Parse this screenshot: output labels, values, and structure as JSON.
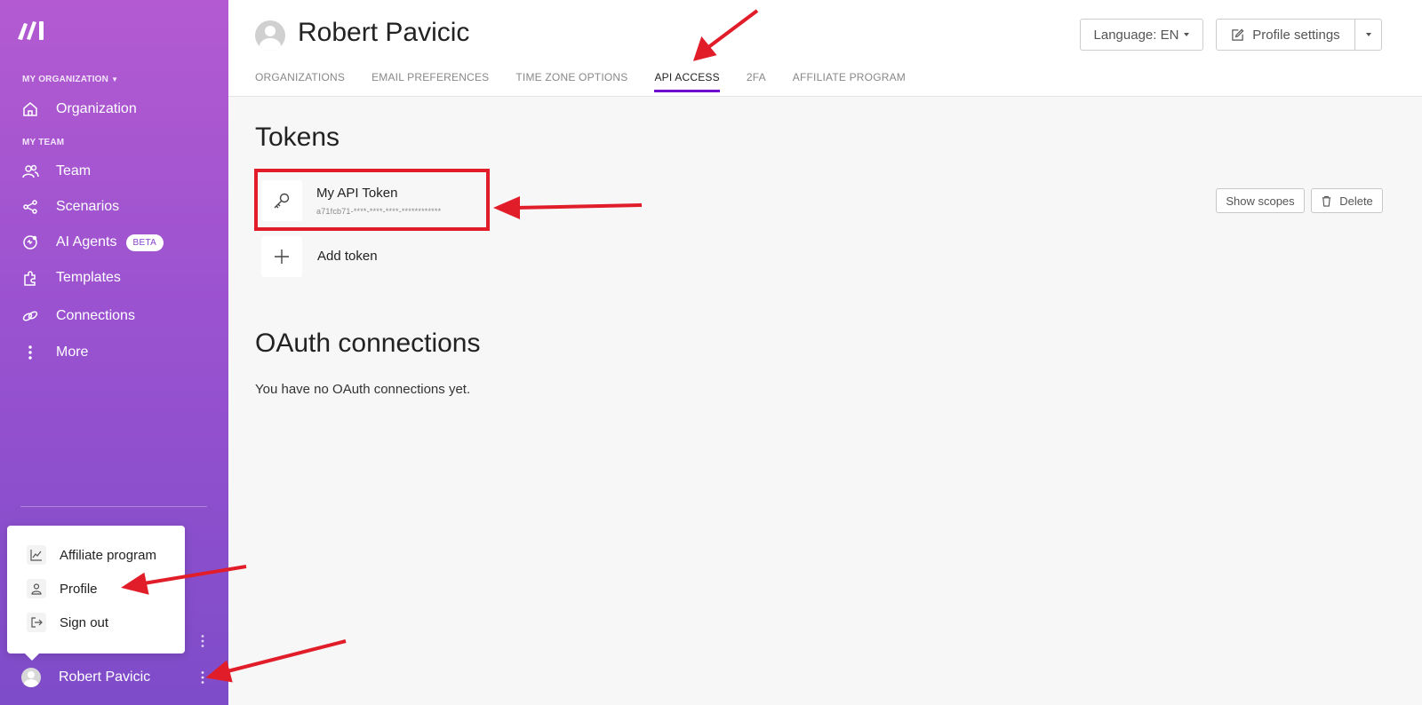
{
  "sidebar": {
    "org_section": "MY ORGANIZATION",
    "team_section": "MY TEAM",
    "items": [
      {
        "label": "Organization",
        "icon": "home-icon"
      },
      {
        "label": "Team",
        "icon": "users-icon"
      },
      {
        "label": "Scenarios",
        "icon": "share-nodes-icon"
      },
      {
        "label": "AI Agents",
        "icon": "ai-agent-icon",
        "badge": "BETA"
      },
      {
        "label": "Templates",
        "icon": "puzzle-icon"
      },
      {
        "label": "Connections",
        "icon": "link-icon"
      },
      {
        "label": "More",
        "icon": "more-vertical-icon"
      }
    ],
    "user_name": "Robert Pavicic"
  },
  "popup_menu": {
    "items": [
      {
        "label": "Affiliate program",
        "icon": "chart-line-icon"
      },
      {
        "label": "Profile",
        "icon": "user-icon"
      },
      {
        "label": "Sign out",
        "icon": "sign-out-icon"
      }
    ]
  },
  "header": {
    "name": "Robert Pavicic",
    "language_button": "Language: EN",
    "profile_settings_button": "Profile settings",
    "tabs": [
      {
        "label": "ORGANIZATIONS",
        "active": false
      },
      {
        "label": "EMAIL PREFERENCES",
        "active": false
      },
      {
        "label": "TIME ZONE OPTIONS",
        "active": false
      },
      {
        "label": "API ACCESS",
        "active": true
      },
      {
        "label": "2FA",
        "active": false
      },
      {
        "label": "AFFILIATE PROGRAM",
        "active": false
      }
    ]
  },
  "tokens": {
    "title": "Tokens",
    "token_name": "My API Token",
    "token_mask": "a71fcb71-****-****-****-************",
    "add_label": "Add token",
    "show_scopes": "Show scopes",
    "delete": "Delete"
  },
  "oauth": {
    "title": "OAuth connections",
    "empty_message": "You have no OAuth connections yet."
  },
  "colors": {
    "accent": "#6d00cc",
    "annotation_red": "#e11d2a"
  }
}
